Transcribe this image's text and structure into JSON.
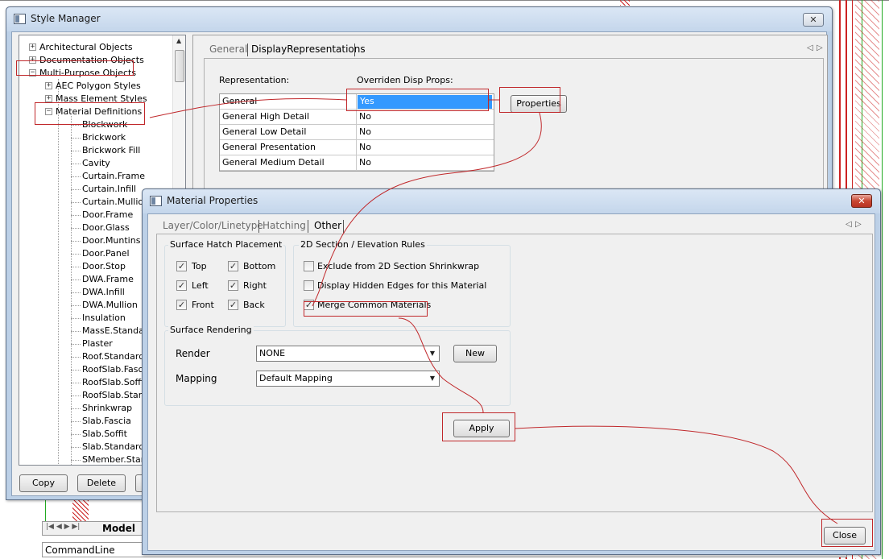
{
  "style_manager": {
    "title": "Style Manager",
    "close_label": "✕",
    "tree": [
      {
        "label": "Architectural Objects",
        "expander": "+"
      },
      {
        "label": "Documentation Objects",
        "expander": "+"
      },
      {
        "label": "Multi-Purpose Objects",
        "expander": "−"
      },
      {
        "label": "AEC Polygon Styles",
        "expander": "+"
      },
      {
        "label": "Mass Element Styles",
        "expander": "+"
      },
      {
        "label": "Material Definitions",
        "expander": "−"
      }
    ],
    "materials": [
      "Blockwork",
      "Brickwork",
      "Brickwork Fill",
      "Cavity",
      "Curtain.Frame",
      "Curtain.Infill",
      "Curtain.Mullion",
      "Door.Frame",
      "Door.Glass",
      "Door.Muntins",
      "Door.Panel",
      "Door.Stop",
      "DWA.Frame",
      "DWA.Infill",
      "DWA.Mullion",
      "Insulation",
      "MassE.Standard",
      "Plaster",
      "Roof.Standard",
      "RoofSlab.Fascia",
      "RoofSlab.Soffit",
      "RoofSlab.Standard",
      "Shrinkwrap",
      "Slab.Fascia",
      "Slab.Soffit",
      "Slab.Standard",
      "SMember.Standard"
    ],
    "buttons": {
      "copy": "Copy",
      "delete": "Delete"
    },
    "tabs": {
      "general": "General",
      "display_reps": "DisplayRepresentations"
    },
    "table": {
      "col_representation": "Representation:",
      "col_overridden": "Overriden Disp Props:",
      "rows": [
        {
          "rep": "General",
          "value": "Yes"
        },
        {
          "rep": "General High Detail",
          "value": "No"
        },
        {
          "rep": "General Low Detail",
          "value": "No"
        },
        {
          "rep": "General Presentation",
          "value": "No"
        },
        {
          "rep": "General Medium Detail",
          "value": "No"
        }
      ]
    },
    "properties_button": "Properties"
  },
  "material_properties": {
    "title": "Material Properties",
    "close_label": "✕",
    "tabs": {
      "layer": "Layer/Color/Linetype",
      "hatching": "Hatching",
      "other": "Other"
    },
    "surface_hatch": {
      "title": "Surface Hatch Placement",
      "top": "Top",
      "bottom": "Bottom",
      "left": "Left",
      "right": "Right",
      "front": "Front",
      "back": "Back"
    },
    "section_rules": {
      "title": "2D Section / Elevation Rules",
      "exclude": "Exclude from 2D Section Shrinkwrap",
      "hidden_edges": "Display Hidden Edges for this Material",
      "merge": "Merge Common Materials"
    },
    "surface_rendering": {
      "title": "Surface Rendering",
      "render_label": "Render",
      "render_value": "NONE",
      "new_button": "New",
      "mapping_label": "Mapping",
      "mapping_value": "Default Mapping"
    },
    "apply_button": "Apply",
    "close_button": "Close"
  },
  "cad": {
    "model_tab": "Model",
    "command_line": "CommandLine"
  },
  "glyphs": {
    "check": "✓",
    "combo_arrow": "▼",
    "left_arrow": "◁",
    "right_arrow": "▷",
    "scroll_up": "▲"
  },
  "colors": {
    "annotation": "#c0282b",
    "selection": "#3399ff",
    "cad_red": "#cc2222",
    "cad_green": "#22aa22"
  }
}
